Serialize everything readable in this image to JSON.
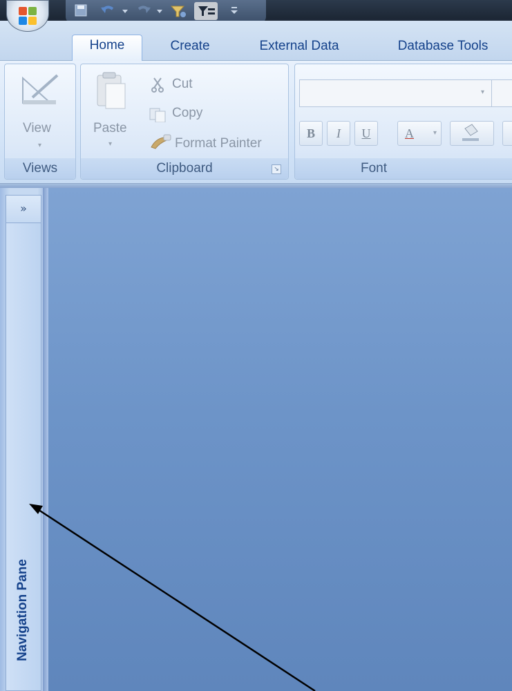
{
  "titlebar": {
    "qat_icons": [
      "save-icon",
      "undo-icon",
      "redo-icon",
      "filter-icon",
      "toggle-filter-icon",
      "customize-qat-icon"
    ]
  },
  "tabs": [
    {
      "label": "Home",
      "active": true
    },
    {
      "label": "Create",
      "active": false
    },
    {
      "label": "External Data",
      "active": false
    },
    {
      "label": "Database Tools",
      "active": false
    }
  ],
  "ribbon": {
    "views": {
      "view_label": "View",
      "group_label": "Views"
    },
    "clipboard": {
      "paste_label": "Paste",
      "cut_label": "Cut",
      "copy_label": "Copy",
      "format_painter_label": "Format Painter",
      "group_label": "Clipboard"
    },
    "font": {
      "font_name_value": "",
      "bold_label": "B",
      "italic_label": "I",
      "underline_label": "U",
      "font_color_label": "A",
      "group_label": "Font"
    }
  },
  "navigation_pane": {
    "toggle_label": "»",
    "label": "Navigation Pane"
  },
  "colors": {
    "accent": "#15428b",
    "workspace": "#6d94c8",
    "ribbon": "#d5e5f8"
  }
}
